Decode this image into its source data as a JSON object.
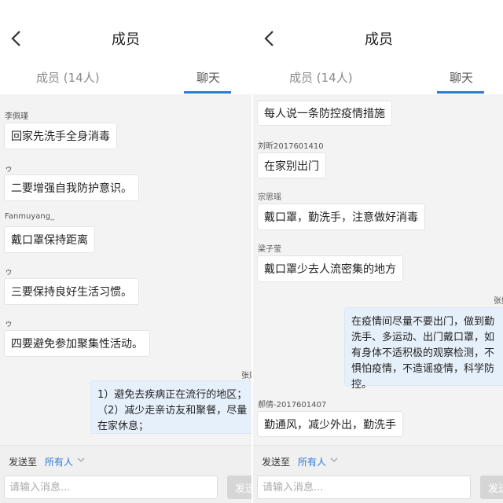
{
  "panels": [
    {
      "title": "成员",
      "tabs": {
        "members": "成员 (14人)",
        "chat": "聊天"
      },
      "messages": [
        {
          "sender": "李佩瑾",
          "text": "回家先洗手全身消毒"
        },
        {
          "sender": "ゥ",
          "text": "二要增强自我防护意识。"
        },
        {
          "sender": "Fanmuyang_",
          "text": "戴口罩保持距离"
        },
        {
          "sender": "ゥ",
          "text": "三要保持良好生活习惯。"
        },
        {
          "sender": "ゥ",
          "text": "四要避免参加聚集性活动。"
        }
      ],
      "self_message": {
        "sender": "张妹",
        "lines": [
          "1）避免去疾病正在流行的地区；",
          "（2）减少走亲访友和聚餐，尽量",
          "在家休息；"
        ]
      },
      "send_to": {
        "label": "发送至",
        "value": "所有人"
      },
      "input": {
        "placeholder": "请输入消息..."
      },
      "send_button": "发送"
    },
    {
      "title": "成员",
      "tabs": {
        "members": "成员 (14人)",
        "chat": "聊天"
      },
      "messages_top": [
        {
          "sender": "",
          "text": "每人说一条防控疫情措施"
        },
        {
          "sender": "刘昕2017601410",
          "text": "在家别出门"
        },
        {
          "sender": "宗思瑶",
          "text": "戴口罩，勤洗手，注意做好消毒"
        },
        {
          "sender": "梁子莹",
          "text": "戴口罩少去人流密集的地方"
        }
      ],
      "self_message": {
        "sender": "张妹",
        "lines": [
          "在疫情间尽量不要出门，做到勤",
          "洗手、多运动、出门戴口罩，如",
          "有身体不适积极的观察检测，不",
          "惧怕疫情，不造谣疫情，科学防",
          "控。"
        ]
      },
      "messages_bottom": [
        {
          "sender": "郝倩-2017601407",
          "text": "勤通风，减少外出，勤洗手"
        }
      ],
      "send_to": {
        "label": "发送至",
        "value": "所有人"
      },
      "input": {
        "placeholder": "请输入消息..."
      },
      "send_button": "发送"
    }
  ]
}
